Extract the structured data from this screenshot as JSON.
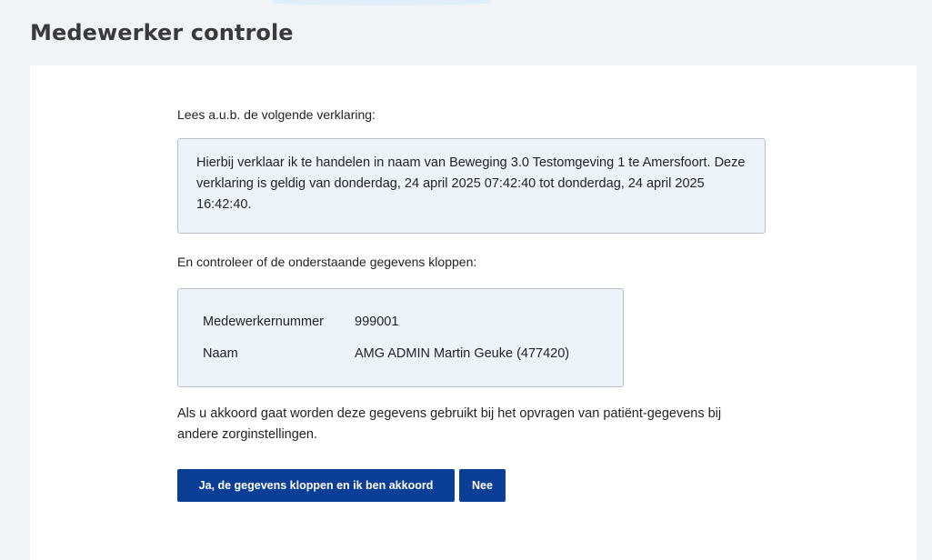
{
  "page": {
    "title": "Medewerker controle"
  },
  "form": {
    "intro": "Lees a.u.b. de volgende verklaring:",
    "statement": "Hierbij verklaar ik te handelen in naam van Beweging 3.0 Testomgeving 1 te Amersfoort. Deze verklaring is geldig van donderdag, 24 april 2025 07:42:40 tot donderdag, 24 april 2025 16:42:40.",
    "check_intro": "En controleer of de onderstaande gegevens kloppen:",
    "details": [
      {
        "label": "Medewerkernummer",
        "value": "999001"
      },
      {
        "label": "Naam",
        "value": "AMG ADMIN Martin Geuke (477420)"
      }
    ],
    "consent_text": "Als u akkoord gaat worden deze gegevens gebruikt bij het opvragen van patiënt-gegevens bij andere zorginstellingen.",
    "buttons": {
      "yes_label": "Ja, de gegevens kloppen en ik ben akkoord",
      "no_label": "Nee"
    }
  },
  "colors": {
    "primary_button": "#0b3e97",
    "info_box_background": "#eef3fa",
    "page_background": "#f1f3f6"
  }
}
